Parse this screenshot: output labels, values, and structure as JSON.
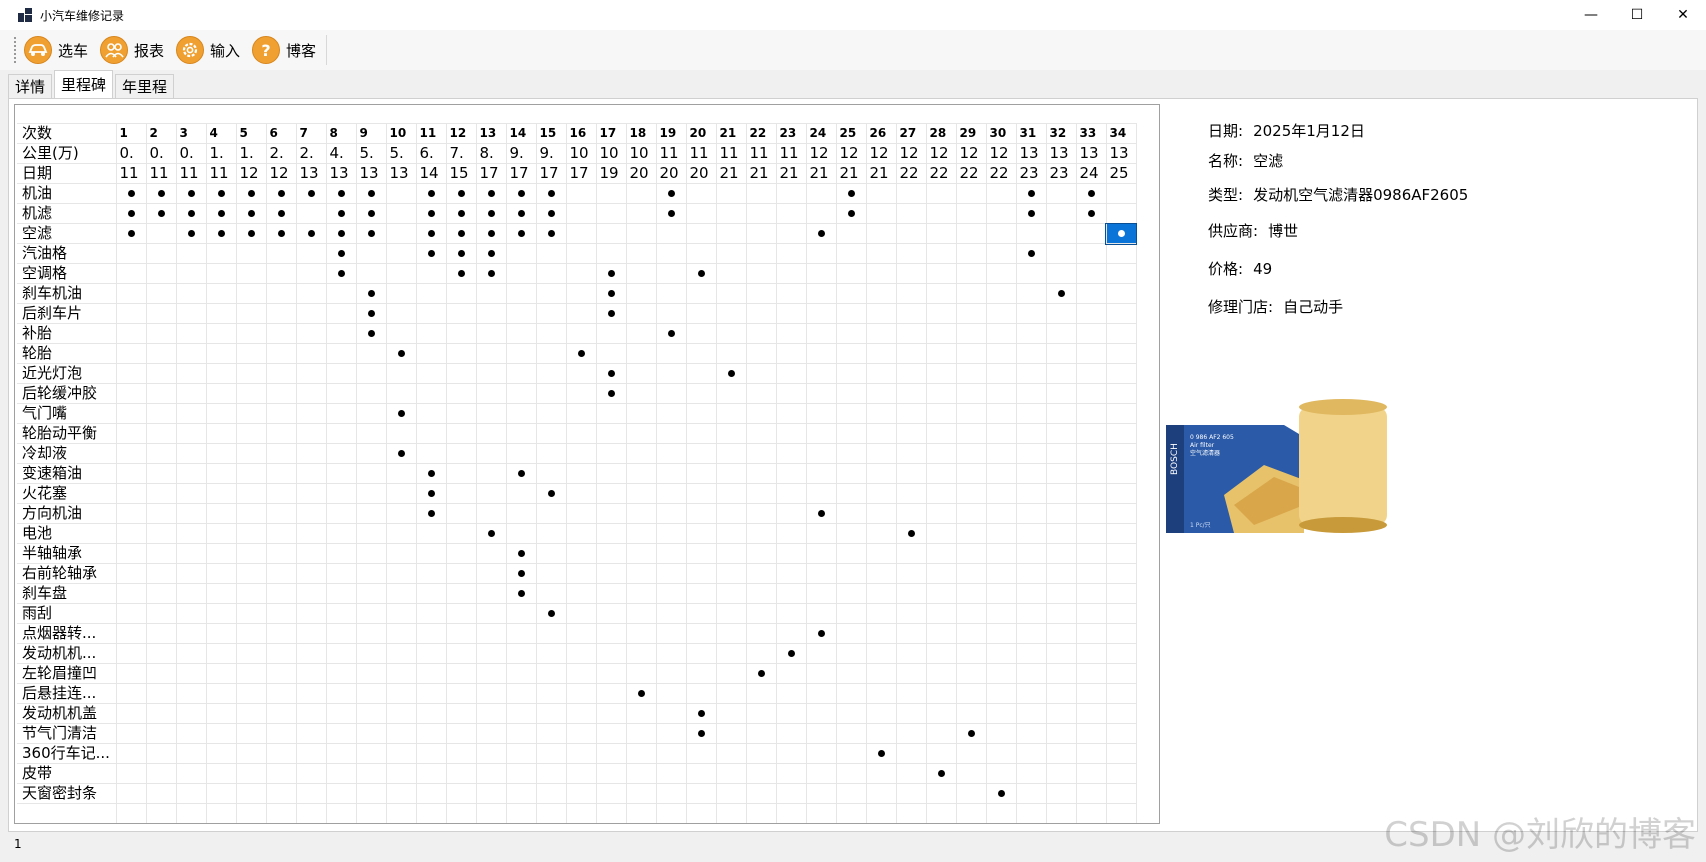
{
  "window": {
    "title": "小汽车维修记录",
    "controls": {
      "minimize": "—",
      "maximize": "☐",
      "close": "✕"
    }
  },
  "toolbar": {
    "items": [
      {
        "label": "选车",
        "icon": "car-icon"
      },
      {
        "label": "报表",
        "icon": "people-icon"
      },
      {
        "label": "输入",
        "icon": "gear-icon"
      },
      {
        "label": "博客",
        "icon": "question-icon"
      }
    ]
  },
  "tabs": [
    {
      "label": "详情",
      "active": false
    },
    {
      "label": "里程碑",
      "active": true
    },
    {
      "label": "年里程",
      "active": false
    }
  ],
  "grid": {
    "header_labels": [
      "次数",
      "公里(万)",
      "日期"
    ],
    "columns": [
      {
        "n": "1",
        "km": "0.",
        "date": "11"
      },
      {
        "n": "2",
        "km": "0.",
        "date": "11"
      },
      {
        "n": "3",
        "km": "0.",
        "date": "11"
      },
      {
        "n": "4",
        "km": "1.",
        "date": "11"
      },
      {
        "n": "5",
        "km": "1.",
        "date": "12"
      },
      {
        "n": "6",
        "km": "2.",
        "date": "12"
      },
      {
        "n": "7",
        "km": "2.",
        "date": "13"
      },
      {
        "n": "8",
        "km": "4.",
        "date": "13"
      },
      {
        "n": "9",
        "km": "5.",
        "date": "13"
      },
      {
        "n": "10",
        "km": "5.",
        "date": "13"
      },
      {
        "n": "11",
        "km": "6.",
        "date": "14"
      },
      {
        "n": "12",
        "km": "7.",
        "date": "15"
      },
      {
        "n": "13",
        "km": "8.",
        "date": "17"
      },
      {
        "n": "14",
        "km": "9.",
        "date": "17"
      },
      {
        "n": "15",
        "km": "9.",
        "date": "17"
      },
      {
        "n": "16",
        "km": "10",
        "date": "17"
      },
      {
        "n": "17",
        "km": "10",
        "date": "19"
      },
      {
        "n": "18",
        "km": "10",
        "date": "20"
      },
      {
        "n": "19",
        "km": "11",
        "date": "20"
      },
      {
        "n": "20",
        "km": "11",
        "date": "20"
      },
      {
        "n": "21",
        "km": "11",
        "date": "21"
      },
      {
        "n": "22",
        "km": "11",
        "date": "21"
      },
      {
        "n": "23",
        "km": "11",
        "date": "21"
      },
      {
        "n": "24",
        "km": "12",
        "date": "21"
      },
      {
        "n": "25",
        "km": "12",
        "date": "21"
      },
      {
        "n": "26",
        "km": "12",
        "date": "21"
      },
      {
        "n": "27",
        "km": "12",
        "date": "22"
      },
      {
        "n": "28",
        "km": "12",
        "date": "22"
      },
      {
        "n": "29",
        "km": "12",
        "date": "22"
      },
      {
        "n": "30",
        "km": "12",
        "date": "22"
      },
      {
        "n": "31",
        "km": "13",
        "date": "23"
      },
      {
        "n": "32",
        "km": "13",
        "date": "23"
      },
      {
        "n": "33",
        "km": "13",
        "date": "24"
      },
      {
        "n": "34",
        "km": "13",
        "date": "25"
      }
    ],
    "rows": [
      {
        "name": "机油",
        "marks": [
          1,
          2,
          3,
          4,
          5,
          6,
          7,
          8,
          9,
          11,
          12,
          13,
          14,
          15,
          19,
          25,
          31,
          33
        ]
      },
      {
        "name": "机滤",
        "marks": [
          1,
          2,
          3,
          4,
          5,
          6,
          8,
          9,
          11,
          12,
          13,
          14,
          15,
          19,
          25,
          31,
          33
        ]
      },
      {
        "name": "空滤",
        "marks": [
          1,
          3,
          4,
          5,
          6,
          7,
          8,
          9,
          11,
          12,
          13,
          14,
          15,
          24,
          34
        ]
      },
      {
        "name": "汽油格",
        "marks": [
          8,
          11,
          12,
          13,
          31
        ]
      },
      {
        "name": "空调格",
        "marks": [
          8,
          12,
          13,
          17,
          20
        ]
      },
      {
        "name": "刹车机油",
        "marks": [
          9,
          17,
          32
        ]
      },
      {
        "name": "后刹车片",
        "marks": [
          9,
          17
        ]
      },
      {
        "name": "补胎",
        "marks": [
          9,
          19
        ]
      },
      {
        "name": "轮胎",
        "marks": [
          10,
          16
        ]
      },
      {
        "name": "近光灯泡",
        "marks": [
          17,
          21
        ]
      },
      {
        "name": "后轮缓冲胶",
        "marks": [
          17
        ]
      },
      {
        "name": "气门嘴",
        "marks": [
          10
        ]
      },
      {
        "name": "轮胎动平衡",
        "marks": []
      },
      {
        "name": "冷却液",
        "marks": [
          10
        ]
      },
      {
        "name": "变速箱油",
        "marks": [
          11,
          14
        ]
      },
      {
        "name": "火花塞",
        "marks": [
          11,
          15
        ]
      },
      {
        "name": "方向机油",
        "marks": [
          11,
          24
        ]
      },
      {
        "name": "电池",
        "marks": [
          13,
          27
        ]
      },
      {
        "name": "半轴轴承",
        "marks": [
          14
        ]
      },
      {
        "name": "右前轮轴承",
        "marks": [
          14
        ]
      },
      {
        "name": "刹车盘",
        "marks": [
          14
        ]
      },
      {
        "name": "雨刮",
        "marks": [
          15
        ]
      },
      {
        "name": "点烟器转...",
        "marks": [
          24
        ]
      },
      {
        "name": "发动机机...",
        "marks": [
          23
        ]
      },
      {
        "name": "左轮眉撞凹",
        "marks": [
          22
        ]
      },
      {
        "name": "后悬挂连...",
        "marks": [
          18
        ]
      },
      {
        "name": "发动机机盖",
        "marks": [
          20
        ]
      },
      {
        "name": "节气门清洁",
        "marks": [
          20,
          29
        ]
      },
      {
        "name": "360行车记...",
        "marks": [
          26
        ]
      },
      {
        "name": "皮带",
        "marks": [
          28
        ]
      },
      {
        "name": "天窗密封条",
        "marks": [
          30
        ]
      }
    ],
    "selected": {
      "row": "空滤",
      "col": 34
    }
  },
  "details": {
    "date": {
      "label": "日期:",
      "value": "2025年1月12日"
    },
    "name": {
      "label": "名称:",
      "value": "空滤"
    },
    "type": {
      "label": "类型:",
      "value": "发动机空气滤清器0986AF2605"
    },
    "supplier": {
      "label": "供应商:",
      "value": "博世"
    },
    "price": {
      "label": "价格:",
      "value": "49"
    },
    "shop": {
      "label": "修理门店:",
      "value": "自己动手"
    }
  },
  "product_image": {
    "brand_text": "BOSCH",
    "box_line1": "0 986 AF2 605",
    "box_line2": "Air filter",
    "box_line3": "空气滤清器",
    "box_qty": "1 Pc/只"
  },
  "statusbar": {
    "text": "1"
  },
  "watermark": {
    "text": "CSDN @刘欣的博客"
  }
}
